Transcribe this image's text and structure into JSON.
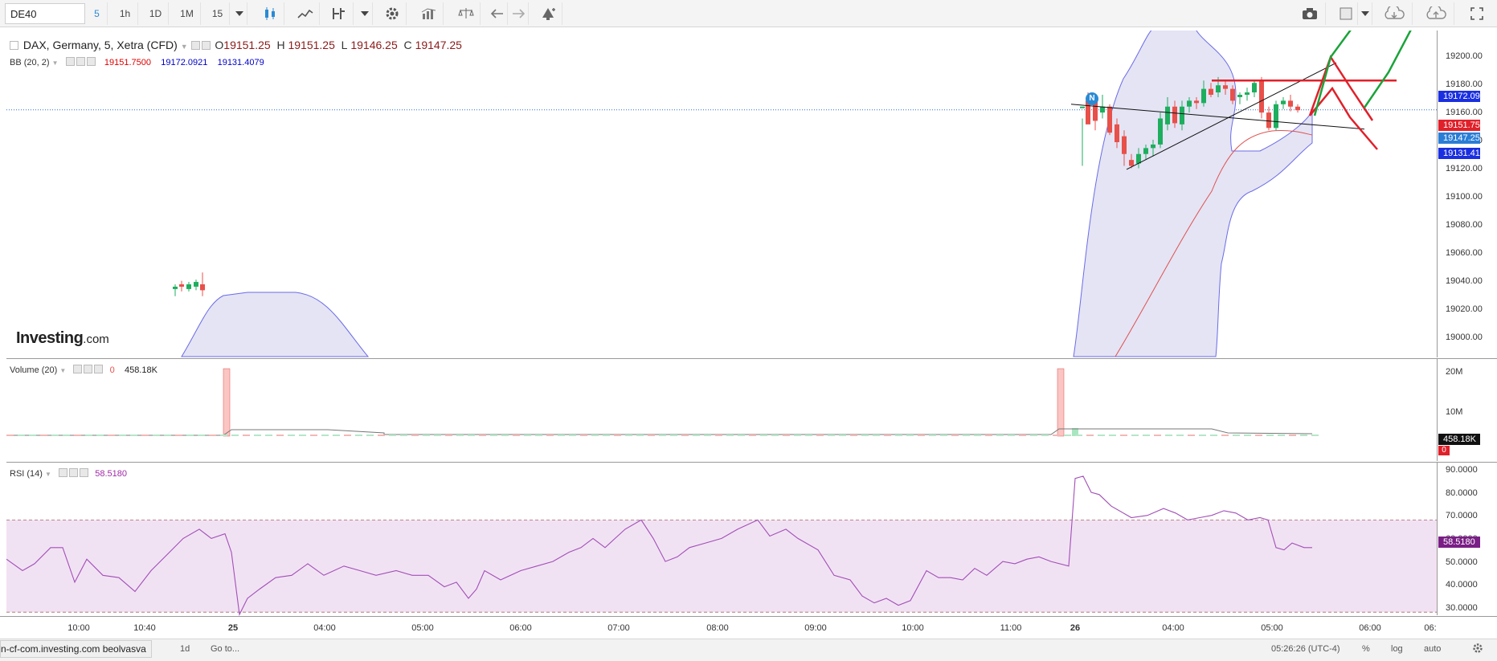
{
  "toolbar": {
    "symbol": "DE40",
    "intervals": [
      "5",
      "1h",
      "1D",
      "1M",
      "15"
    ],
    "active_interval": "5"
  },
  "main": {
    "title": "DAX, Germany, 5, Xetra (CFD)",
    "ohlc": {
      "o_label": "O",
      "o": "19151.25",
      "h_label": "H",
      "h": "19151.25",
      "l_label": "L",
      "l": "19146.25",
      "c_label": "C",
      "c": "19147.25"
    },
    "bb": {
      "label": "BB (20, 2)",
      "basis": "19151.7500",
      "upper": "19172.0921",
      "lower": "19131.4079"
    },
    "watermark_brand": "Investing",
    "watermark_domain": ".com",
    "news_badge": "N",
    "y_ticks": [
      "19200.00",
      "19180.00",
      "19160.00",
      "19140.00",
      "19120.00",
      "19100.00",
      "19080.00",
      "19060.00",
      "19040.00",
      "19020.00",
      "19000.00"
    ],
    "tags": {
      "upper": "19172.09",
      "basis": "19151.75",
      "close": "19147.25",
      "lower": "19131.41"
    }
  },
  "volume": {
    "label": "Volume (20)",
    "zero": "0",
    "value": "458.18K",
    "y_ticks": [
      "20M",
      "10M"
    ],
    "tag_value": "458.18K",
    "tag_zero": "0"
  },
  "rsi": {
    "label": "RSI (14)",
    "value": "58.5180",
    "y_ticks": [
      "90.0000",
      "80.0000",
      "70.0000",
      "60.0000",
      "50.0000",
      "40.0000",
      "30.0000"
    ],
    "tag": "58.5180"
  },
  "time_axis": {
    "ticks": [
      "10:00",
      "10:40",
      "25",
      "04:00",
      "05:00",
      "06:00",
      "07:00",
      "08:00",
      "09:00",
      "10:00",
      "11:00",
      "26",
      "04:00",
      "05:00",
      "06:00",
      "06:"
    ]
  },
  "bottom_bar": {
    "range": "1d",
    "goto": "Go to...",
    "clock": "05:26:26 (UTC-4)",
    "percent": "%",
    "log": "log",
    "auto": "auto"
  },
  "status_url": "n-cf-com.investing.com beolvasva",
  "colors": {
    "up": "#1eae5e",
    "down": "#e8504a",
    "bb_band": "#6b6be8",
    "bb_fill": "#e4e4f4",
    "rsi_line": "#a24fb8",
    "rsi_fill": "#f1e2f3",
    "accent": "#2a8ad4"
  }
}
